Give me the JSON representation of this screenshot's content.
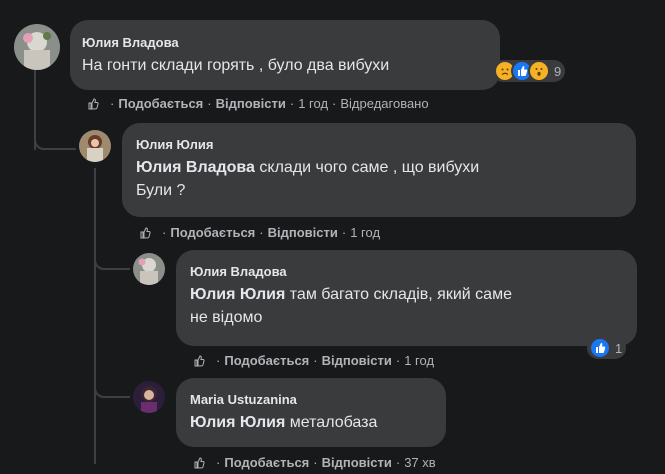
{
  "top_cut_text": "· · ·",
  "comments": [
    {
      "author": "Юлия Владова",
      "mention": "",
      "text": "На гонти склади горять , було два вибухи",
      "actions": {
        "like": "Подобається",
        "reply": "Відповісти",
        "time": "1 год",
        "edited": "Відредаговано"
      },
      "reactions": {
        "icons": [
          "sad",
          "like",
          "wow"
        ],
        "count": "9"
      }
    },
    {
      "author": "Юлия Юлия",
      "mention": "Юлия Владова",
      "text_line1": " склади чого саме , що вибухи",
      "text_line2": "Були ?",
      "actions": {
        "like": "Подобається",
        "reply": "Відповісти",
        "time": "1 год"
      }
    },
    {
      "author": "Юлия Владова",
      "mention": "Юлия Юлия",
      "text_line1": " там багато складів, який саме",
      "text_line2": "не відомо",
      "actions": {
        "like": "Подобається",
        "reply": "Відповісти",
        "time": "1 год"
      },
      "reactions": {
        "icons": [
          "like"
        ],
        "count": "1"
      }
    },
    {
      "author": "Maria Ustuzanina",
      "mention": "Юлия Юлия",
      "text_line1": " металобаза",
      "actions": {
        "like": "Подобається",
        "reply": "Відповісти",
        "time": "37 хв"
      }
    }
  ],
  "colors": {
    "background": "#18191a",
    "bubble": "#3a3b3c",
    "text": "#e4e6eb",
    "secondary": "#b0b3b8",
    "like_blue": "#1877f2",
    "emoji_yellow": "#f7b125"
  }
}
